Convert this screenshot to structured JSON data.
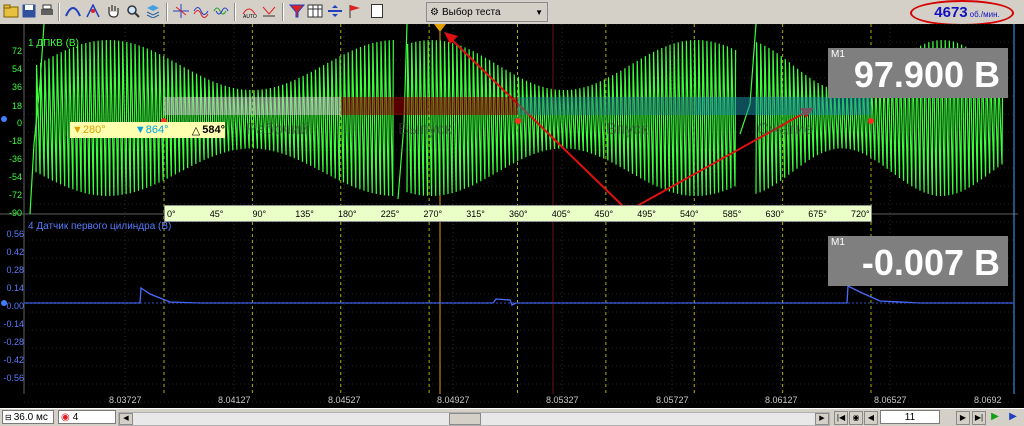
{
  "toolbar": {
    "test_select": "Выбор теста",
    "rpm_value": "4673",
    "rpm_unit": "об./мин."
  },
  "channels": {
    "ch1_label": "1 ДПКВ (В)",
    "ch1_yticks": [
      "72",
      "54",
      "36",
      "18",
      "0",
      "-18",
      "-36",
      "-54",
      "-72",
      "-90"
    ],
    "ch4_label": "4 Датчик первого цилиндра (В)",
    "ch4_yticks": [
      "0.56",
      "0.42",
      "0.28",
      "0.14",
      "0.00",
      "-0.14",
      "-0.28",
      "-0.42",
      "-0.56"
    ]
  },
  "measurements": {
    "m1_top_tag": "M1",
    "m1_top_value": "97.900 В",
    "m1_bottom_tag": "M1",
    "m1_bottom_value": "-0.007 В"
  },
  "cursors": {
    "c1": "280°",
    "c2": "864°",
    "delta_symbol": "△",
    "delta": "584°"
  },
  "phases": [
    "Рабочий",
    "Выпуск",
    "Впуск",
    "Сжатие"
  ],
  "degree_scale": [
    "0°",
    "45°",
    "90°",
    "135°",
    "180°",
    "225°",
    "270°",
    "315°",
    "360°",
    "405°",
    "450°",
    "495°",
    "540°",
    "585°",
    "630°",
    "675°",
    "720°"
  ],
  "time_axis": [
    "8.03727",
    "8.04127",
    "8.04527",
    "8.04927",
    "8.05327",
    "8.05727",
    "8.06127",
    "8.06527",
    "8.0692"
  ],
  "status": {
    "timebase": "36.0 мс",
    "channel": "4",
    "page": "11"
  },
  "colors": {
    "ch1": "#3cff3c",
    "ch4": "#4a6cff",
    "rpm": "#1010c0",
    "arrows": "#e01010"
  }
}
